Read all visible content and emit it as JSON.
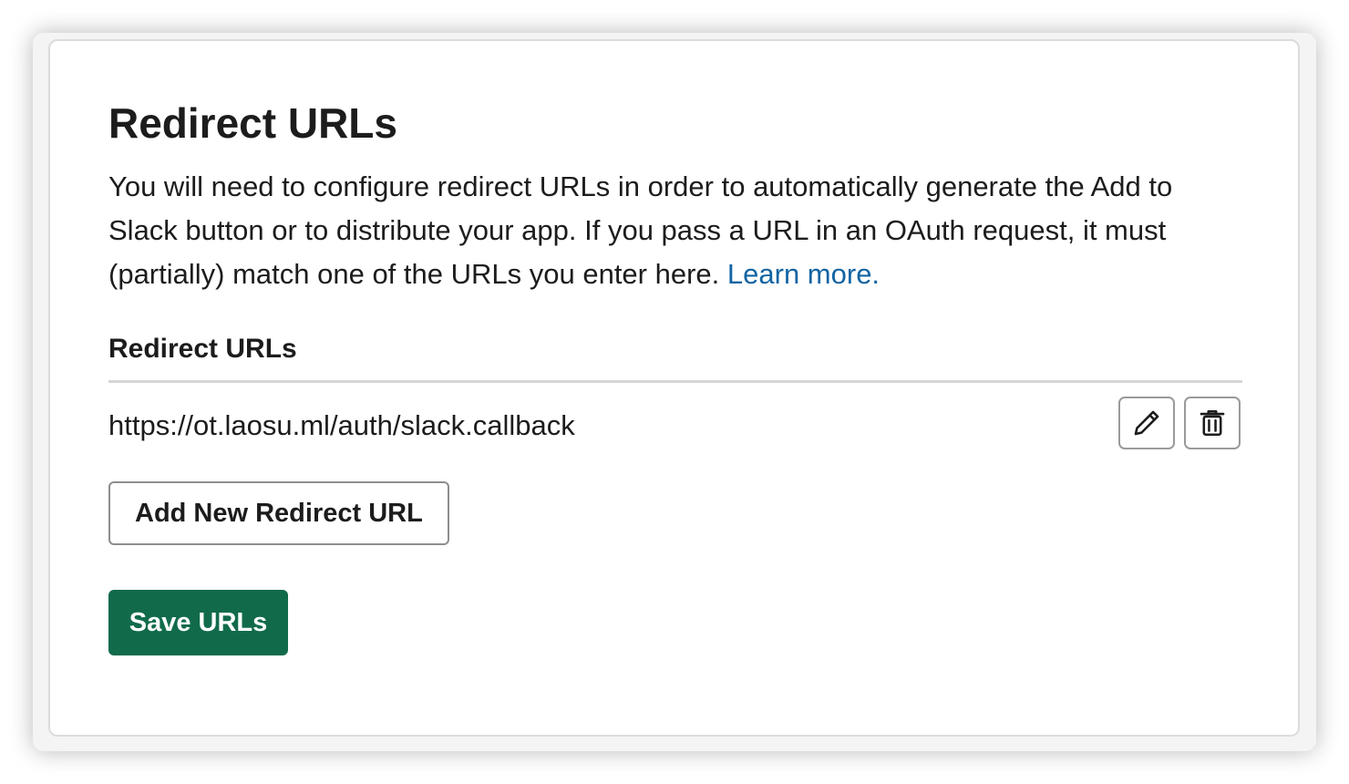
{
  "section": {
    "title": "Redirect URLs",
    "description": "You will need to configure redirect URLs in order to automatically generate the Add to Slack button or to distribute your app. If you pass a URL in an OAuth request, it must (partially) match one of the URLs you enter here.",
    "learn_more_label": "Learn more."
  },
  "redirect_list": {
    "label": "Redirect URLs",
    "urls": [
      {
        "value": "https://ot.laosu.ml/auth/slack.callback",
        "edit_icon": "pencil-icon",
        "delete_icon": "trash-icon"
      }
    ]
  },
  "actions": {
    "add_label": "Add New Redirect URL",
    "save_label": "Save URLs"
  },
  "colors": {
    "primary_button": "#116b4b",
    "link": "#1264a3",
    "text": "#1d1c1d"
  }
}
